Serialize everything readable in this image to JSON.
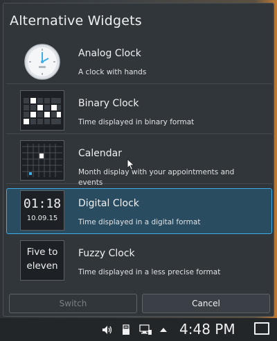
{
  "popup": {
    "title": "Alternative Widgets"
  },
  "widgets": [
    {
      "name": "Analog Clock",
      "description": "A clock with hands",
      "icon": "analog-clock-icon"
    },
    {
      "name": "Binary Clock",
      "description": "Time displayed in binary format",
      "icon": "binary-clock-icon"
    },
    {
      "name": "Calendar",
      "description": "Month display with your appointments and events",
      "icon": "calendar-icon"
    },
    {
      "name": "Digital Clock",
      "description": "Time displayed in a digital format",
      "icon": "digital-clock-icon",
      "selected": true,
      "preview_time": "01:18",
      "preview_date": "10.09.15"
    },
    {
      "name": "Fuzzy Clock",
      "description": "Time displayed in a less precise format",
      "icon": "fuzzy-clock-icon",
      "preview_text": "Five to eleven"
    }
  ],
  "buttons": {
    "switch_label": "Switch",
    "cancel_label": "Cancel"
  },
  "taskbar": {
    "clock": "4:48 PM",
    "tray_icons": [
      "volume-icon",
      "usb-device-icon",
      "network-icon",
      "expand-arrow-icon",
      "show-desktop-icon"
    ]
  },
  "colors": {
    "accent": "#3daee9",
    "selected_bg": "#2a4c61",
    "panel_bg": "#31363b"
  }
}
